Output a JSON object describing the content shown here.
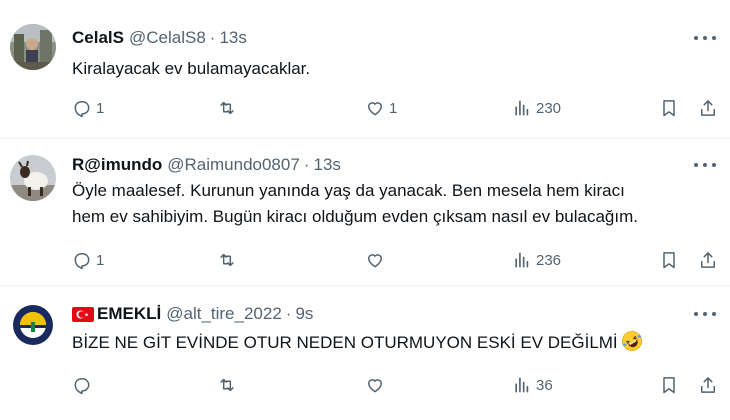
{
  "tweets": [
    {
      "name": "CelalS",
      "handle": "@CelalS8",
      "separator": "·",
      "time": "13s",
      "text_lines": [
        "Kiralayacak ev bulamayacaklar."
      ],
      "replies": "1",
      "retweets": "",
      "likes": "1",
      "views": "230",
      "avatar": "photo-avatar"
    },
    {
      "name": "R@imundo",
      "handle": "@Raimundo0807",
      "separator": "·",
      "time": "13s",
      "text_lines": [
        "Öyle maalesef. Kurunun yanında yaş da yanacak. Ben mesela hem kiracı",
        "hem ev sahibiyim. Bugün kiracı olduğum evden çıksam nasıl ev bulacağım."
      ],
      "replies": "1",
      "retweets": "",
      "likes": "",
      "views": "236",
      "avatar": "goat-avatar"
    },
    {
      "name": "EMEKLİ",
      "name_flag": "turkey-flag-icon",
      "handle": "@alt_tire_2022",
      "separator": "·",
      "time": "9s",
      "text_lines": [
        "BİZE NE GİT EVİNDE OTUR NEDEN OTURMUYON ESKİ EV DEĞİLMİ"
      ],
      "text_emoji": "rolling-laughing-emoji",
      "replies": "",
      "retweets": "",
      "likes": "",
      "views": "36",
      "avatar": "fenerbahce-logo-avatar"
    }
  ],
  "icons": {
    "reply": "reply-icon",
    "retweet": "retweet-icon",
    "like": "like-icon",
    "views": "views-icon",
    "bookmark": "bookmark-icon",
    "share": "share-icon",
    "more": "more-icon"
  },
  "colors": {
    "text": "#0f1419",
    "secondary": "#536471",
    "divider": "#eff3f4",
    "flag_red": "#e30a17",
    "logo_navy": "#1b2a5e",
    "logo_yellow": "#f2c200"
  }
}
